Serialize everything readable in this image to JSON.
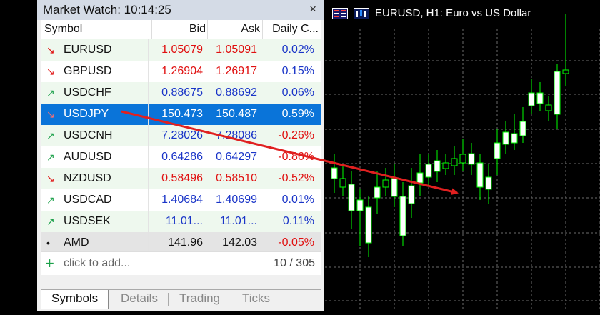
{
  "market_watch": {
    "title": "Market Watch: 10:14:25",
    "close_glyph": "×",
    "columns": [
      "Symbol",
      "Bid",
      "Ask",
      "Daily C..."
    ],
    "rows": [
      {
        "symbol": "EURUSD",
        "bid": "1.05079",
        "ask": "1.05091",
        "daily_change": "0.02%",
        "direction": "down",
        "price_color": "red",
        "change_color": "blue"
      },
      {
        "symbol": "GBPUSD",
        "bid": "1.26904",
        "ask": "1.26917",
        "daily_change": "0.15%",
        "direction": "down",
        "price_color": "red",
        "change_color": "blue"
      },
      {
        "symbol": "USDCHF",
        "bid": "0.88675",
        "ask": "0.88692",
        "daily_change": "0.06%",
        "direction": "up",
        "price_color": "blue",
        "change_color": "blue"
      },
      {
        "symbol": "USDJPY",
        "bid": "150.473",
        "ask": "150.487",
        "daily_change": "0.59%",
        "direction": "down",
        "price_color": "white",
        "change_color": "white",
        "selected": true
      },
      {
        "symbol": "USDCNH",
        "bid": "7.28026",
        "ask": "7.28086",
        "daily_change": "-0.26%",
        "direction": "up",
        "price_color": "blue",
        "change_color": "red"
      },
      {
        "symbol": "AUDUSD",
        "bid": "0.64286",
        "ask": "0.64297",
        "daily_change": "-0.86%",
        "direction": "up",
        "price_color": "blue",
        "change_color": "red"
      },
      {
        "symbol": "NZDUSD",
        "bid": "0.58496",
        "ask": "0.58510",
        "daily_change": "-0.52%",
        "direction": "down",
        "price_color": "red",
        "change_color": "red"
      },
      {
        "symbol": "USDCAD",
        "bid": "1.40684",
        "ask": "1.40699",
        "daily_change": "0.01%",
        "direction": "up",
        "price_color": "blue",
        "change_color": "blue"
      },
      {
        "symbol": "USDSEK",
        "bid": "11.01...",
        "ask": "11.01...",
        "daily_change": "0.11%",
        "direction": "up",
        "price_color": "blue",
        "change_color": "blue"
      },
      {
        "symbol": "AMD",
        "bid": "141.96",
        "ask": "142.03",
        "daily_change": "-0.05%",
        "direction": "neutral",
        "price_color": "dark",
        "change_color": "red"
      }
    ],
    "add_row": {
      "label": "click to add...",
      "count": "10 / 305"
    },
    "tabs": [
      "Symbols",
      "Details",
      "Trading",
      "Ticks"
    ],
    "active_tab": "Symbols"
  },
  "chart": {
    "title": "EURUSD, H1:  Euro vs US Dollar",
    "icons": [
      "chart-grid-icon",
      "one-click-trading-icon"
    ],
    "background_color": "#000000",
    "grid_color": "#6b6b6b",
    "bull_color": "#00ff00",
    "candle_fill_color": "#ffffff"
  },
  "annotation": {
    "arrow_color": "#e02020"
  },
  "colors": {
    "red": "#e01010",
    "blue": "#1a35c8",
    "selection": "#0a74d9",
    "up_arrow": "#1da14b"
  }
}
